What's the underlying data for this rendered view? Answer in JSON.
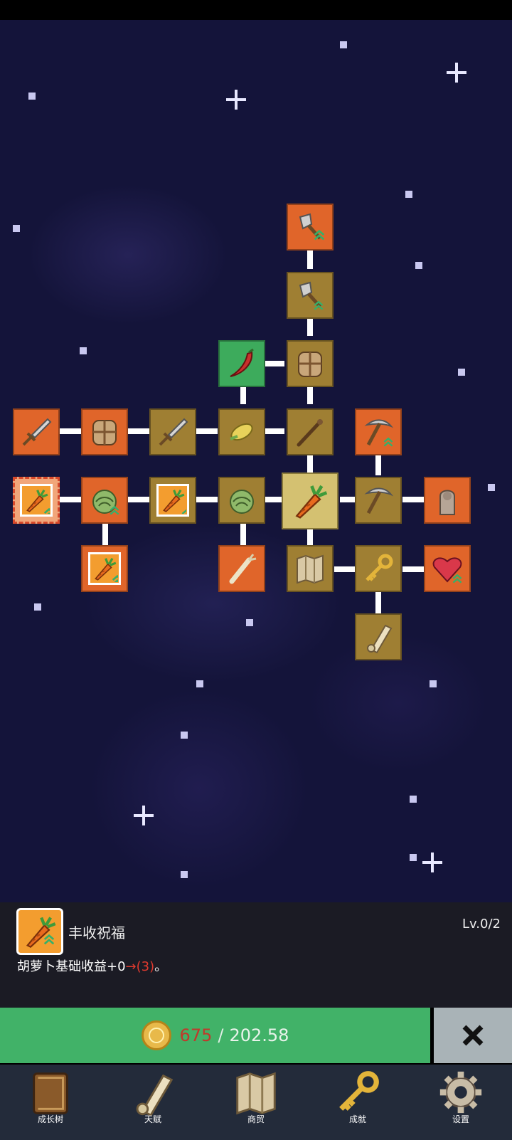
{
  "panel": {
    "skill_name": "丰收祝福",
    "level": "Lv.0/2",
    "desc_prefix": "胡萝卜基础收益+0",
    "desc_highlight": "→(3)",
    "desc_suffix": "。"
  },
  "buy": {
    "cost": "675",
    "separator": "/",
    "owned": "202.58"
  },
  "nav": [
    {
      "label": "成长树",
      "icon": "book-icon"
    },
    {
      "label": "天赋",
      "icon": "scroll-icon"
    },
    {
      "label": "商贸",
      "icon": "map-icon"
    },
    {
      "label": "成就",
      "icon": "key-icon"
    },
    {
      "label": "设置",
      "icon": "gear-icon"
    }
  ],
  "tree_nodes": [
    {
      "id": "shovel-upgrade-1",
      "icon": "shovel-icon",
      "state": "available"
    },
    {
      "id": "shovel-upgrade-2",
      "icon": "shovel-icon",
      "state": "purchased"
    },
    {
      "id": "chili",
      "icon": "chili-icon",
      "state": "unlocked"
    },
    {
      "id": "backpack-1",
      "icon": "backpack-icon",
      "state": "purchased"
    },
    {
      "id": "sword-1",
      "icon": "sword-icon",
      "state": "available"
    },
    {
      "id": "backpack-2",
      "icon": "backpack-icon",
      "state": "available"
    },
    {
      "id": "sword-2",
      "icon": "sword-icon",
      "state": "purchased"
    },
    {
      "id": "corn",
      "icon": "corn-icon",
      "state": "purchased"
    },
    {
      "id": "wand",
      "icon": "wand-icon",
      "state": "purchased"
    },
    {
      "id": "pickaxe-1",
      "icon": "pickaxe-icon",
      "state": "available"
    },
    {
      "id": "harvest-blessing",
      "icon": "carrot-icon",
      "state": "selected"
    },
    {
      "id": "cabbage-1",
      "icon": "cabbage-icon",
      "state": "available"
    },
    {
      "id": "carrot-2",
      "icon": "carrot-icon",
      "state": "purchased"
    },
    {
      "id": "cabbage-2",
      "icon": "cabbage-icon",
      "state": "purchased"
    },
    {
      "id": "carrot-center",
      "icon": "carrot-icon",
      "state": "root"
    },
    {
      "id": "pickaxe-2",
      "icon": "pickaxe-icon",
      "state": "purchased"
    },
    {
      "id": "statue",
      "icon": "statue-icon",
      "state": "available"
    },
    {
      "id": "carrot-3",
      "icon": "carrot-icon",
      "state": "available"
    },
    {
      "id": "leek",
      "icon": "leek-icon",
      "state": "available"
    },
    {
      "id": "map",
      "icon": "map-icon",
      "state": "purchased"
    },
    {
      "id": "key",
      "icon": "key-icon",
      "state": "purchased"
    },
    {
      "id": "heart",
      "icon": "heart-icon",
      "state": "available"
    },
    {
      "id": "scroll",
      "icon": "scroll-icon",
      "state": "purchased"
    }
  ]
}
